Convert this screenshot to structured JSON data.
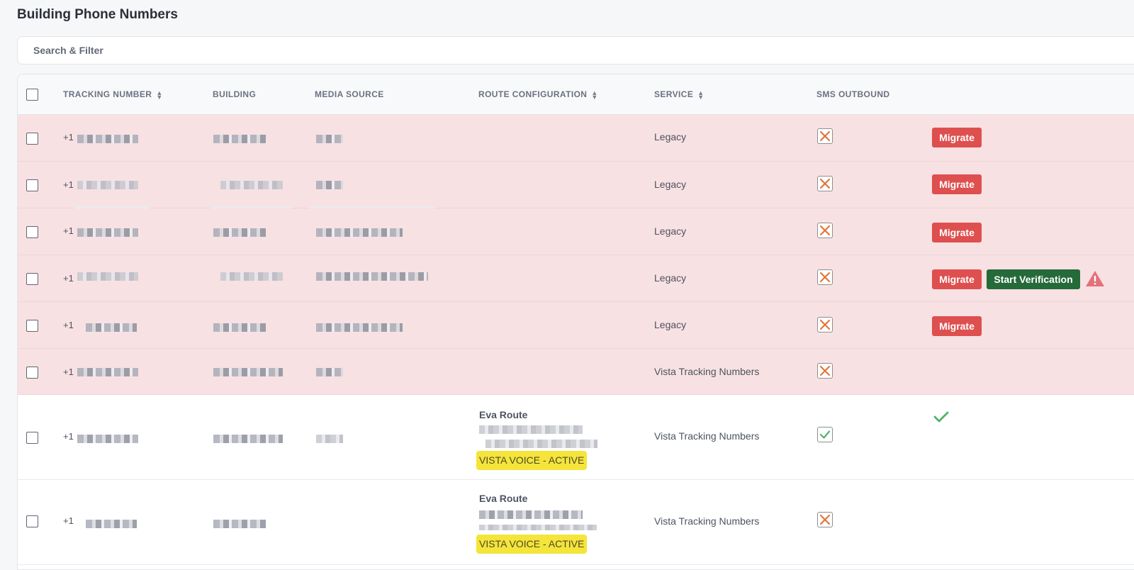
{
  "page": {
    "title": "Building Phone Numbers"
  },
  "search": {
    "label": "Search & Filter"
  },
  "table": {
    "headers": {
      "tracking_number": "TRACKING NUMBER",
      "building": "BUILDING",
      "media_source": "MEDIA SOURCE",
      "route_configuration": "ROUTE CONFIGURATION",
      "service": "SERVICE",
      "sms_outbound": "SMS OUTBOUND"
    },
    "rows": [
      {
        "prefix": "+1",
        "service": "Legacy",
        "sms": "x",
        "migrate": "Migrate"
      },
      {
        "prefix": "+1",
        "service": "Legacy",
        "sms": "x",
        "migrate": "Migrate"
      },
      {
        "prefix": "+1",
        "service": "Legacy",
        "sms": "x",
        "migrate": "Migrate"
      },
      {
        "prefix": "+1",
        "service": "Legacy",
        "sms": "x",
        "migrate": "Migrate",
        "verify": "Start Verification"
      },
      {
        "prefix": "+1",
        "service": "Legacy",
        "sms": "x",
        "migrate": "Migrate"
      },
      {
        "prefix": "+1",
        "service": "Vista Tracking Numbers",
        "sms": "x"
      },
      {
        "prefix": "+1",
        "service": "Vista Tracking Numbers",
        "sms": "check",
        "route": "Eva Route",
        "badge": "VISTA VOICE - ACTIVE"
      },
      {
        "prefix": "+1",
        "service": "Vista Tracking Numbers",
        "sms": "x",
        "route": "Eva Route",
        "badge": "VISTA VOICE - ACTIVE"
      }
    ]
  },
  "colors": {
    "error_row": "#f8e1e2",
    "migrate": "#de4f4f",
    "verify": "#256a39",
    "badge": "#f5e43a",
    "x_icon": "#e0763c",
    "check": "#4fb36a"
  }
}
